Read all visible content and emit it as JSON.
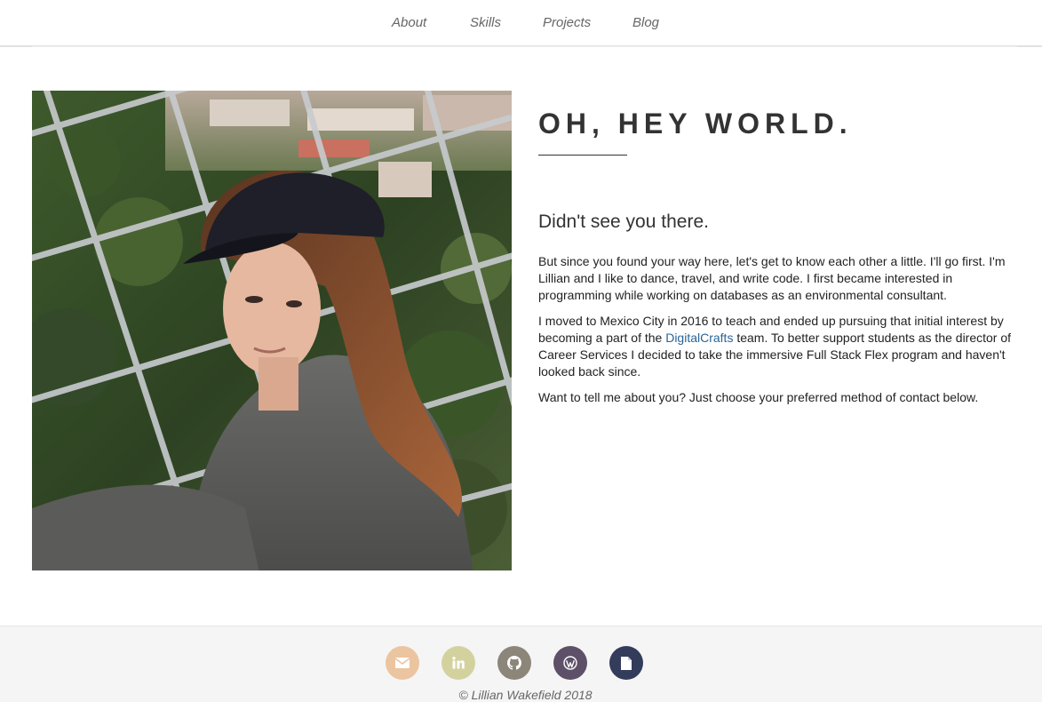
{
  "nav": {
    "items": [
      {
        "label": "About"
      },
      {
        "label": "Skills"
      },
      {
        "label": "Projects"
      },
      {
        "label": "Blog"
      }
    ]
  },
  "about": {
    "photo_alt": "Portrait photo",
    "headline": "OH, HEY WORLD.",
    "subheading": "Didn't see you there.",
    "para1": "But since you found your way here, let's get to know each other a little. I'll go first. I'm Lillian and I like to dance, travel, and write code. I first became interested in programming while working on databases as an environmental consultant.",
    "para2_before": "I moved to Mexico City in 2016 to teach and ended up pursuing that initial interest by becoming a part of the ",
    "para2_link": "DigitalCrafts",
    "para2_after": " team. To better support students as the director of Career Services I decided to take the immersive Full Stack Flex program and haven't looked back since.",
    "para3": "Want to tell me about you? Just choose your preferred method of contact below."
  },
  "footer": {
    "contact_icons": [
      {
        "icon": "envelope-icon",
        "color": "#ebc4a0"
      },
      {
        "icon": "linkedin-icon",
        "color": "#d3d29e"
      },
      {
        "icon": "github-icon",
        "color": "#8c857a"
      },
      {
        "icon": "wordpress-icon",
        "color": "#5d5068"
      },
      {
        "icon": "document-icon",
        "color": "#343c5c"
      }
    ],
    "copyright": "© Lillian Wakefield 2018"
  },
  "colors": {
    "link": "#2a6496",
    "nav_text": "#666666",
    "headline": "#333333"
  }
}
